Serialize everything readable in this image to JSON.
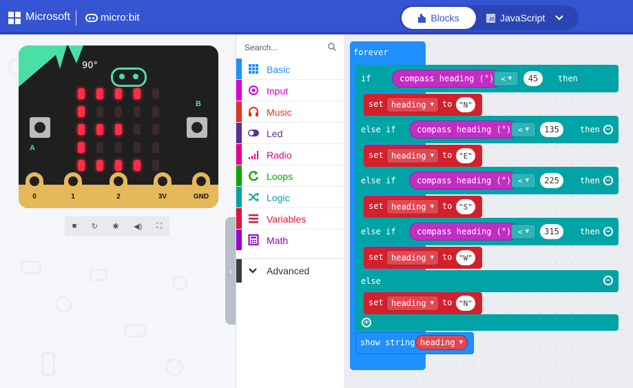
{
  "header": {
    "brand": "Microsoft",
    "product": "micro:bit",
    "tab_blocks": "Blocks",
    "tab_javascript": "JavaScript",
    "js_badge": "JS"
  },
  "simulator": {
    "heading_readout": "90°",
    "button_a": "A",
    "button_b": "B",
    "pins": [
      "0",
      "1",
      "2",
      "3V",
      "GND"
    ]
  },
  "toolbox": {
    "search_placeholder": "Search...",
    "categories": [
      {
        "label": "Basic",
        "color": "#1e90ff",
        "icon": "grid-icon"
      },
      {
        "label": "Input",
        "color": "#d400d4",
        "icon": "target-icon"
      },
      {
        "label": "Music",
        "color": "#e63022",
        "icon": "headphones-icon"
      },
      {
        "label": "Led",
        "color": "#5c2d91",
        "icon": "toggle-icon"
      },
      {
        "label": "Radio",
        "color": "#e3008c",
        "icon": "signal-icon"
      },
      {
        "label": "Loops",
        "color": "#00aa00",
        "icon": "loop-icon"
      },
      {
        "label": "Logic",
        "color": "#00a4a6",
        "icon": "shuffle-icon"
      },
      {
        "label": "Variables",
        "color": "#dc143c",
        "icon": "list-icon"
      },
      {
        "label": "Math",
        "color": "#9400d3",
        "icon": "calculator-icon"
      }
    ],
    "advanced": "Advanced"
  },
  "blocks": {
    "forever": "forever",
    "if": "if",
    "else_if": "else if",
    "else": "else",
    "then": "then",
    "compass": "compass heading (°)",
    "lt": "<",
    "set": "set",
    "to": "to",
    "var_name": "heading",
    "thresholds": [
      "45",
      "135",
      "225",
      "315"
    ],
    "values": [
      "\"N\"",
      "\"E\"",
      "\"S\"",
      "\"W\"",
      "\"N\""
    ],
    "show_string": "show string"
  }
}
